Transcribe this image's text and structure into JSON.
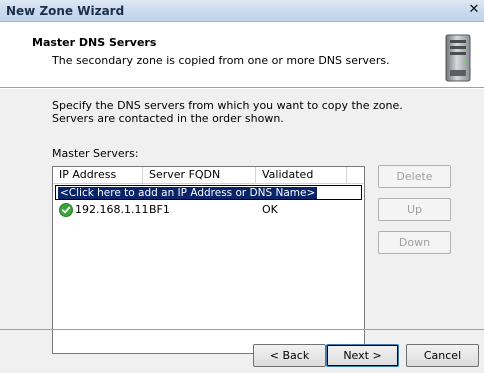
{
  "window": {
    "title": "New Zone Wizard",
    "close_glyph": "✕"
  },
  "header": {
    "title": "Master DNS Servers",
    "subtitle": "The secondary zone is copied from one or more DNS servers.",
    "icon": "server-tower-icon"
  },
  "body": {
    "intro": "Specify the DNS servers from which you want to copy the zone.  Servers are contacted in the order shown.",
    "list_label": "Master Servers:"
  },
  "list": {
    "columns": [
      "IP Address",
      "Server FQDN",
      "Validated"
    ],
    "add_prompt": "<Click here to add an IP Address or DNS Name>",
    "rows": [
      {
        "ip": "192.168.1.11",
        "fqdn": "BF1",
        "validated": "OK",
        "status_icon": "green-check-icon",
        "status_color": "#3aa53a"
      }
    ]
  },
  "side_buttons": {
    "delete": "Delete",
    "up": "Up",
    "down": "Down"
  },
  "footer": {
    "back": "< Back",
    "next": "Next >",
    "cancel": "Cancel"
  }
}
